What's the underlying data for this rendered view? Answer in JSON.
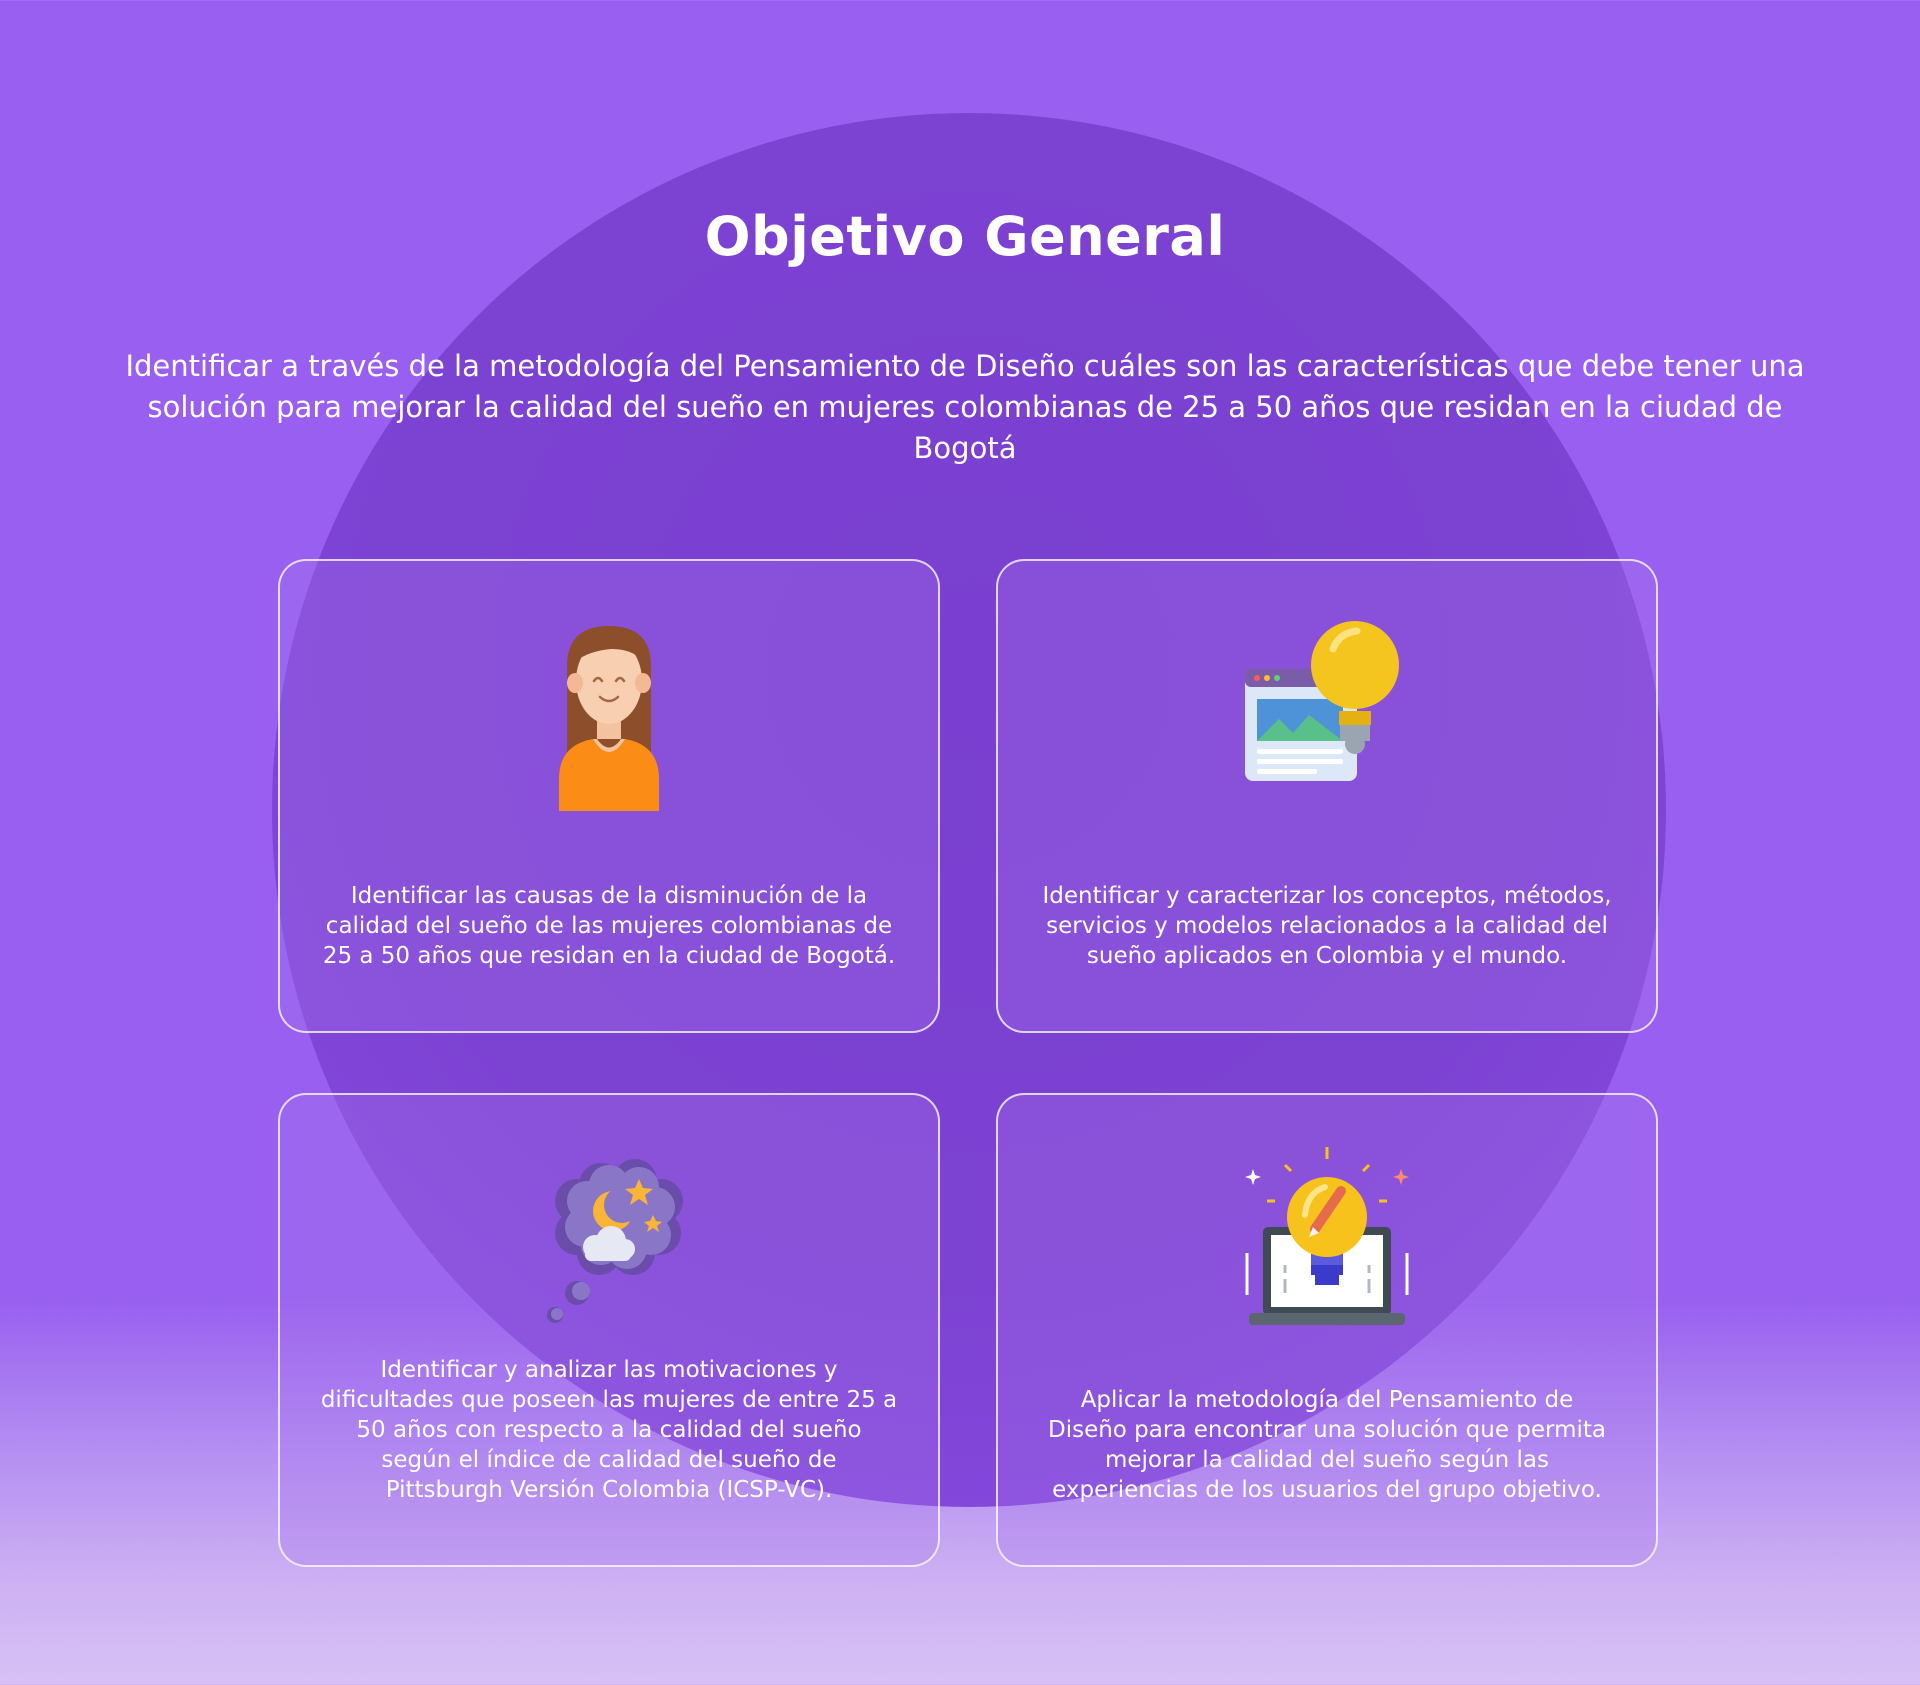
{
  "page": {
    "title": "Objetivo General",
    "subtitle": "Identificar a través de la metodología del Pensamiento de Diseño cuáles son las características que debe tener una solución para mejorar la calidad del sueño en mujeres colombianas de 25 a 50 años que residan en la ciudad de Bogotá"
  },
  "cards": [
    {
      "icon": "woman-avatar-icon",
      "text": "Identificar las causas de la disminución de la calidad del sueño de las mujeres colombianas de 25 a 50 años que residan en la ciudad de Bogotá."
    },
    {
      "icon": "browser-lightbulb-icon",
      "text": "Identificar y caracterizar los conceptos, métodos, servicios y modelos relacionados a la calidad del sueño aplicados en Colombia y el mundo."
    },
    {
      "icon": "night-thought-bubble-icon",
      "text": "Identificar y analizar las motivaciones y dificultades que poseen las mujeres de entre 25 a 50 años con respecto a la calidad del sueño según el índice de calidad del sueño de Pittsburgh Versión Colombia (ICSP-VC)."
    },
    {
      "icon": "laptop-creative-idea-icon",
      "text": "Aplicar la metodología del Pensamiento de Diseño para encontrar una solución que permita mejorar la calidad del sueño según las experiencias de los usuarios del grupo objetivo."
    }
  ],
  "colors": {
    "background": "#985ff0",
    "circle": "#7c42d2",
    "text": "#ffffff",
    "card_border": "#ffffff"
  }
}
